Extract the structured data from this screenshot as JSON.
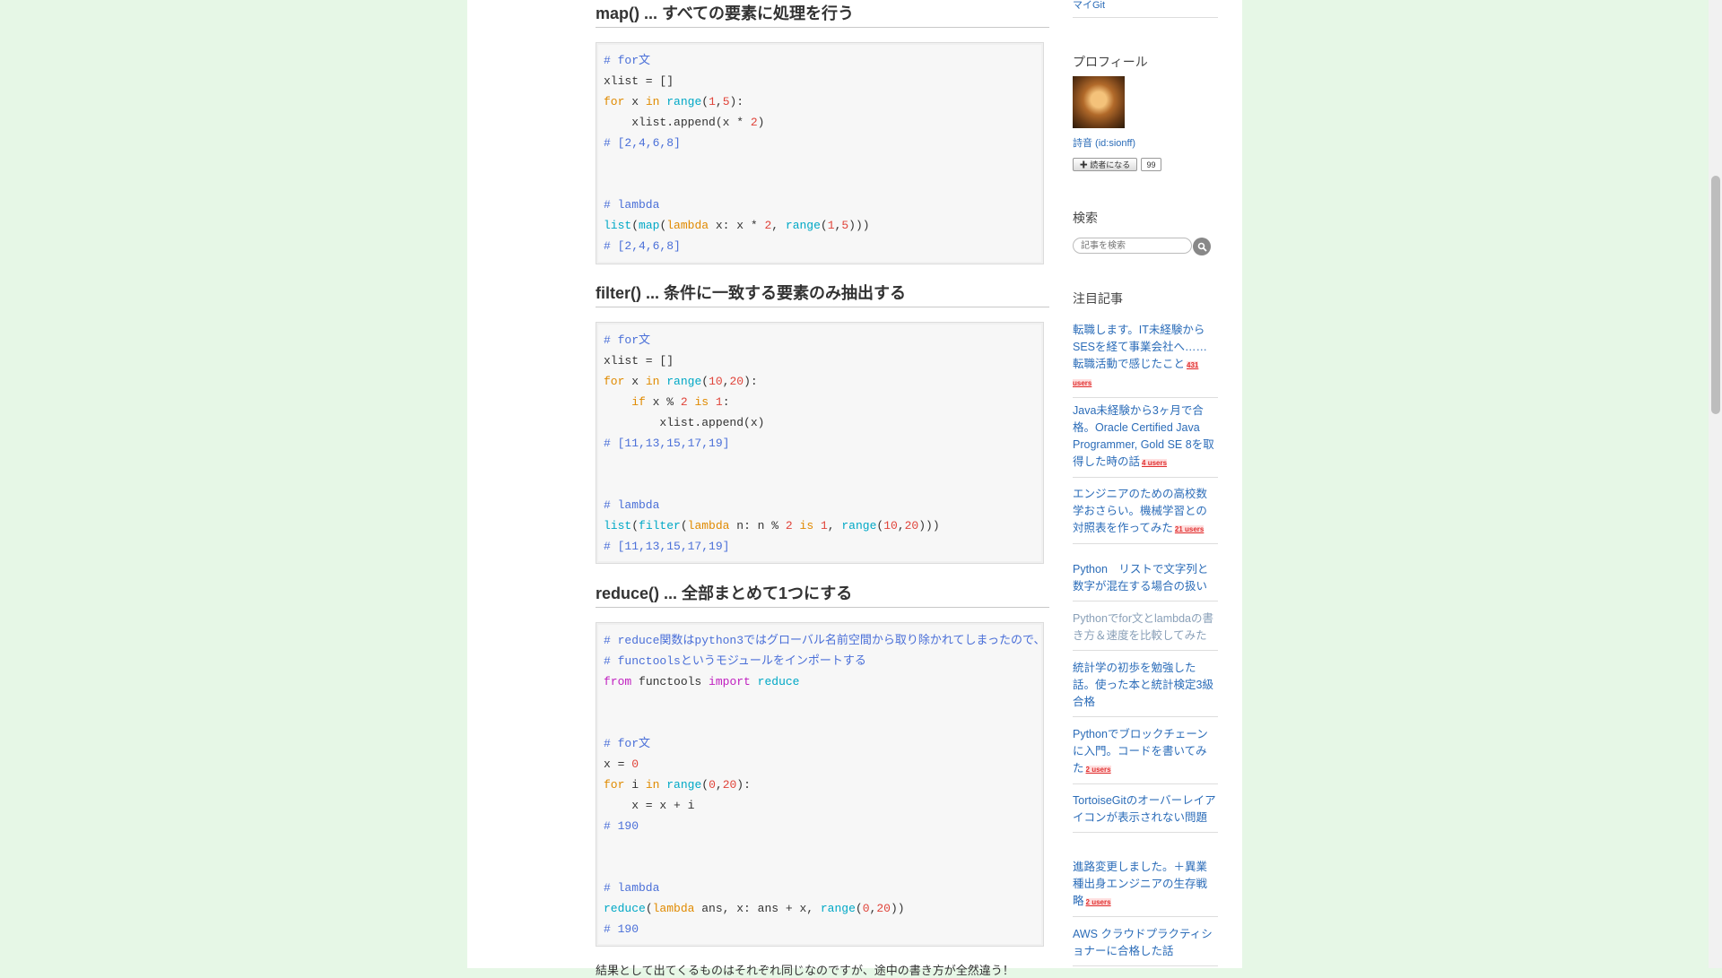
{
  "sections": [
    {
      "title": "map() ... すべての要素に処理を行う",
      "lines": [
        [
          [
            "c",
            "# for文"
          ]
        ],
        [
          [
            "p",
            "xlist = []"
          ]
        ],
        [
          [
            "k",
            "for"
          ],
          [
            "p",
            " x "
          ],
          [
            "k",
            "in"
          ],
          [
            "p",
            " "
          ],
          [
            "b",
            "range"
          ],
          [
            "p",
            "("
          ],
          [
            "n",
            "1"
          ],
          [
            "p",
            ","
          ],
          [
            "n",
            "5"
          ],
          [
            "p",
            "):"
          ]
        ],
        [
          [
            "p",
            "    xlist.append(x * "
          ],
          [
            "n",
            "2"
          ],
          [
            "p",
            ")"
          ]
        ],
        [
          [
            "c",
            "# [2,4,6,8]"
          ]
        ],
        [
          [
            "p",
            ""
          ]
        ],
        [
          [
            "p",
            ""
          ]
        ],
        [
          [
            "c",
            "# lambda"
          ]
        ],
        [
          [
            "b",
            "list"
          ],
          [
            "p",
            "("
          ],
          [
            "b",
            "map"
          ],
          [
            "p",
            "("
          ],
          [
            "k",
            "lambda"
          ],
          [
            "p",
            " x: x * "
          ],
          [
            "n",
            "2"
          ],
          [
            "p",
            ", "
          ],
          [
            "b",
            "range"
          ],
          [
            "p",
            "("
          ],
          [
            "n",
            "1"
          ],
          [
            "p",
            ","
          ],
          [
            "n",
            "5"
          ],
          [
            "p",
            ")))"
          ]
        ],
        [
          [
            "c",
            "# [2,4,6,8]"
          ]
        ]
      ]
    },
    {
      "title": "filter() ... 条件に一致する要素のみ抽出する",
      "lines": [
        [
          [
            "c",
            "# for文"
          ]
        ],
        [
          [
            "p",
            "xlist = []"
          ]
        ],
        [
          [
            "k",
            "for"
          ],
          [
            "p",
            " x "
          ],
          [
            "k",
            "in"
          ],
          [
            "p",
            " "
          ],
          [
            "b",
            "range"
          ],
          [
            "p",
            "("
          ],
          [
            "n",
            "10"
          ],
          [
            "p",
            ","
          ],
          [
            "n",
            "20"
          ],
          [
            "p",
            "):"
          ]
        ],
        [
          [
            "p",
            "    "
          ],
          [
            "k",
            "if"
          ],
          [
            "p",
            " x % "
          ],
          [
            "n",
            "2"
          ],
          [
            "p",
            " "
          ],
          [
            "k",
            "is"
          ],
          [
            "p",
            " "
          ],
          [
            "n",
            "1"
          ],
          [
            "p",
            ":"
          ]
        ],
        [
          [
            "p",
            "        xlist.append(x)"
          ]
        ],
        [
          [
            "c",
            "# [11,13,15,17,19]"
          ]
        ],
        [
          [
            "p",
            ""
          ]
        ],
        [
          [
            "p",
            ""
          ]
        ],
        [
          [
            "c",
            "# lambda"
          ]
        ],
        [
          [
            "b",
            "list"
          ],
          [
            "p",
            "("
          ],
          [
            "b",
            "filter"
          ],
          [
            "p",
            "("
          ],
          [
            "k",
            "lambda"
          ],
          [
            "p",
            " n: n % "
          ],
          [
            "n",
            "2"
          ],
          [
            "p",
            " "
          ],
          [
            "k",
            "is"
          ],
          [
            "p",
            " "
          ],
          [
            "n",
            "1"
          ],
          [
            "p",
            ", "
          ],
          [
            "b",
            "range"
          ],
          [
            "p",
            "("
          ],
          [
            "n",
            "10"
          ],
          [
            "p",
            ","
          ],
          [
            "n",
            "20"
          ],
          [
            "p",
            ")))"
          ]
        ],
        [
          [
            "c",
            "# [11,13,15,17,19]"
          ]
        ]
      ]
    },
    {
      "title": "reduce() ... 全部まとめて1つにする",
      "lines": [
        [
          [
            "c",
            "# reduce関数はpython3ではグローバル名前空間から取り除かれてしまったので、"
          ]
        ],
        [
          [
            "c",
            "# functoolsというモジュールをインポートする"
          ]
        ],
        [
          [
            "i",
            "from"
          ],
          [
            "p",
            " functools "
          ],
          [
            "i",
            "import"
          ],
          [
            "p",
            " "
          ],
          [
            "b",
            "reduce"
          ]
        ],
        [
          [
            "p",
            ""
          ]
        ],
        [
          [
            "p",
            ""
          ]
        ],
        [
          [
            "c",
            "# for文"
          ]
        ],
        [
          [
            "p",
            "x = "
          ],
          [
            "n",
            "0"
          ]
        ],
        [
          [
            "k",
            "for"
          ],
          [
            "p",
            " i "
          ],
          [
            "k",
            "in"
          ],
          [
            "p",
            " "
          ],
          [
            "b",
            "range"
          ],
          [
            "p",
            "("
          ],
          [
            "n",
            "0"
          ],
          [
            "p",
            ","
          ],
          [
            "n",
            "20"
          ],
          [
            "p",
            "):"
          ]
        ],
        [
          [
            "p",
            "    x = x + i"
          ]
        ],
        [
          [
            "c",
            "# 190"
          ]
        ],
        [
          [
            "p",
            ""
          ]
        ],
        [
          [
            "p",
            ""
          ]
        ],
        [
          [
            "c",
            "# lambda"
          ]
        ],
        [
          [
            "b",
            "reduce"
          ],
          [
            "p",
            "("
          ],
          [
            "k",
            "lambda"
          ],
          [
            "p",
            " ans, x: ans + x, "
          ],
          [
            "b",
            "range"
          ],
          [
            "p",
            "("
          ],
          [
            "n",
            "0"
          ],
          [
            "p",
            ","
          ],
          [
            "n",
            "20"
          ],
          [
            "p",
            "))"
          ]
        ],
        [
          [
            "c",
            "# 190"
          ]
        ]
      ]
    }
  ],
  "trailing_text": "結果として出てくるものはそれぞれ同じなのですが、途中の書き方が全然違う！",
  "sidebar": {
    "top_link": "マイGit",
    "profile_heading": "プロフィール",
    "user_name": "詩音 (id:sionff)",
    "subscribe_label": "読者になる",
    "subscribe_count": "99",
    "search_heading": "検索",
    "search_placeholder": "記事を検索",
    "featured_heading": "注目記事",
    "articles": [
      {
        "title": "転職します。IT未経験からSESを経て事業会社へ……転職活動で感じたこと",
        "users": "431 users"
      },
      {
        "title": "Java未経験から3ヶ月で合格。Oracle Certified Java Programmer, Gold SE 8を取得した時の話",
        "users": "4 users"
      },
      {
        "title": "エンジニアのための高校数学おさらい。機械学習との対照表を作ってみた",
        "users": "21 users"
      },
      {
        "title": "Python　リストで文字列と数字が混在する場合の扱い",
        "users": ""
      },
      {
        "title": "Pythonでfor文とlambdaの書き方＆速度を比較してみた",
        "users": ""
      },
      {
        "title": "統計学の初歩を勉強した話。使った本と統計検定3級合格",
        "users": ""
      },
      {
        "title": "Pythonでブロックチェーンに入門。コードを書いてみた",
        "users": "2 users"
      },
      {
        "title": "TortoiseGitのオーバーレイアイコンが表示されない問題",
        "users": ""
      },
      {
        "title": "進路変更しました。＋異業種出身エンジニアの生存戦略",
        "users": "2 users"
      },
      {
        "title": "AWS クラウドプラクティショナーに合格した話",
        "users": ""
      }
    ]
  },
  "colors": {
    "background": "#e6f7e6",
    "comment": "#4a6fd8",
    "keyword": "#e08a00",
    "builtin": "#00a8c6",
    "number": "#e0443a",
    "import_keyword": "#c020c0",
    "link": "#2b6cb8"
  }
}
